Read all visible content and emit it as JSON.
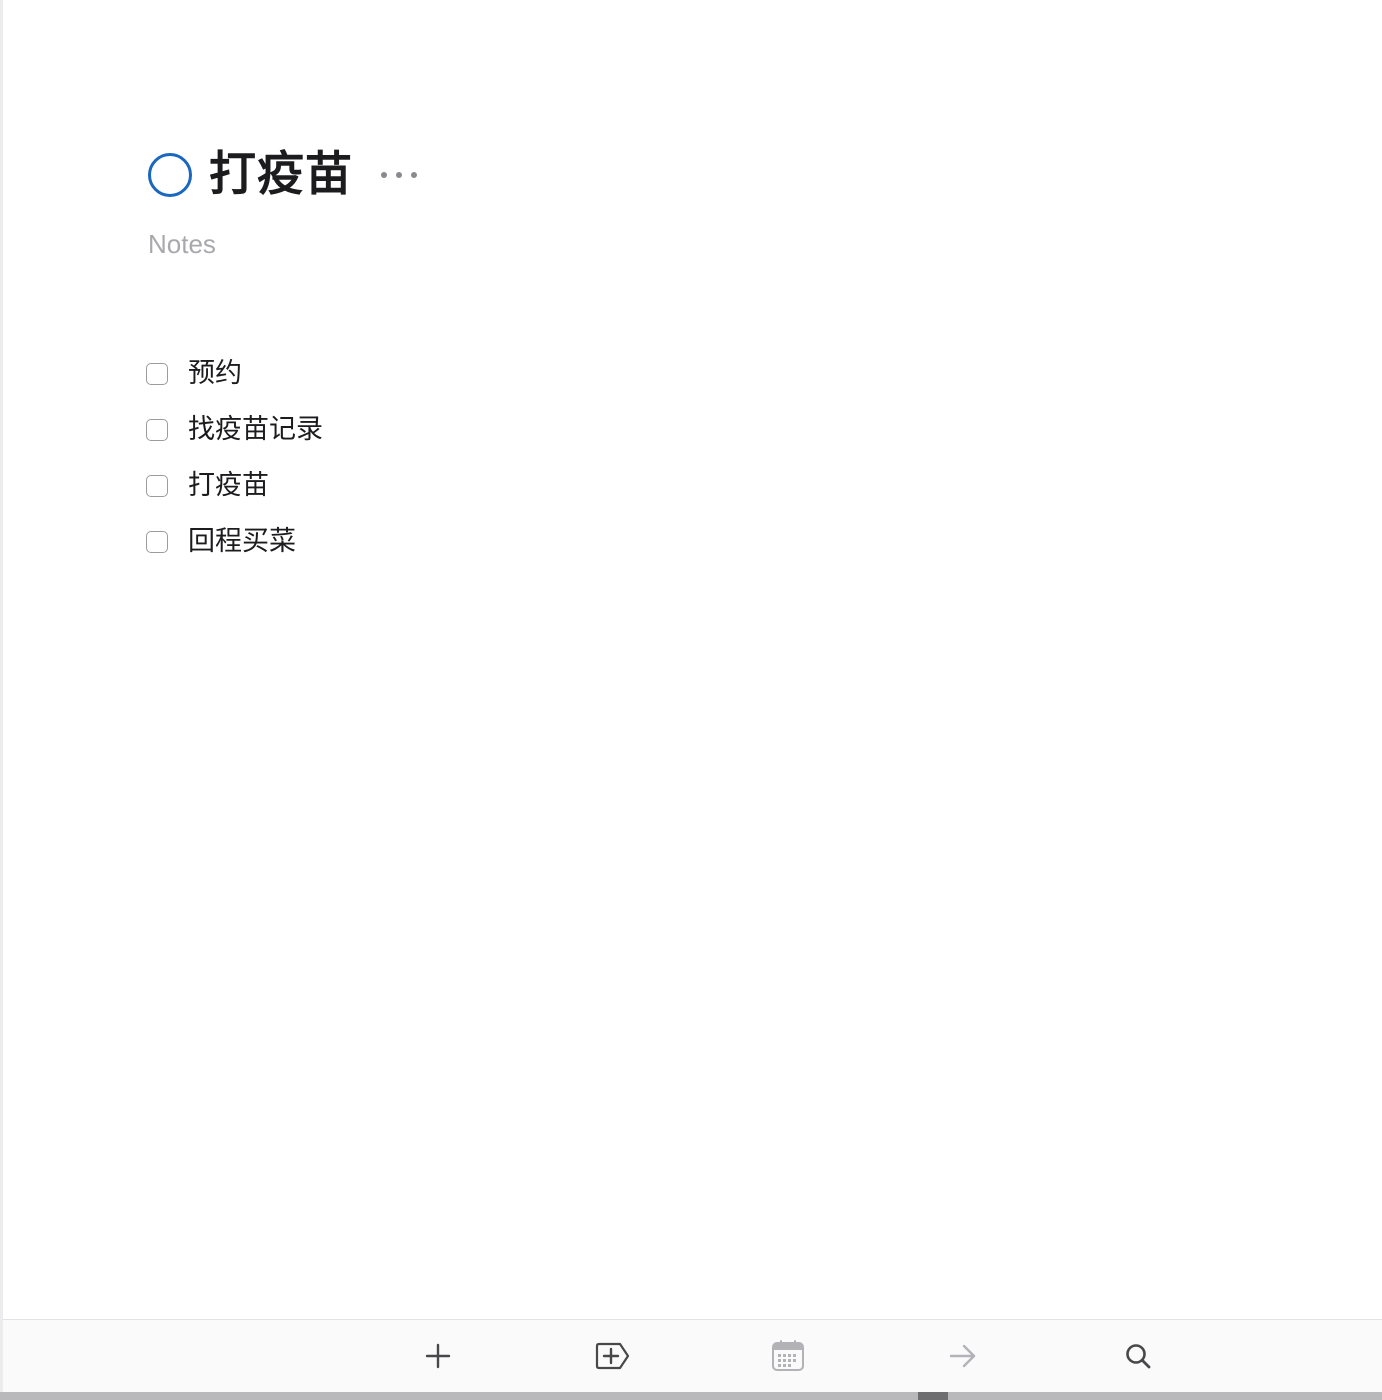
{
  "project": {
    "title": "打疫苗",
    "progress": 0,
    "progress_color": "#1a67c0",
    "more_icon": "ellipsis-icon"
  },
  "notes": {
    "placeholder": "Notes",
    "value": ""
  },
  "tasks": [
    {
      "title": "预约",
      "completed": false
    },
    {
      "title": "找疫苗记录",
      "completed": false
    },
    {
      "title": "打疫苗",
      "completed": false
    },
    {
      "title": "回程买菜",
      "completed": false
    }
  ],
  "toolbar": {
    "buttons": [
      {
        "name": "new-todo",
        "icon": "plus-icon",
        "enabled": true
      },
      {
        "name": "new-heading",
        "icon": "add-heading-icon",
        "enabled": true
      },
      {
        "name": "when",
        "icon": "calendar-icon",
        "enabled": false
      },
      {
        "name": "move",
        "icon": "arrow-right-icon",
        "enabled": false
      },
      {
        "name": "quick-find",
        "icon": "search-icon",
        "enabled": true
      }
    ],
    "active_color": "#48484a",
    "disabled_color": "#b3b3b7"
  }
}
